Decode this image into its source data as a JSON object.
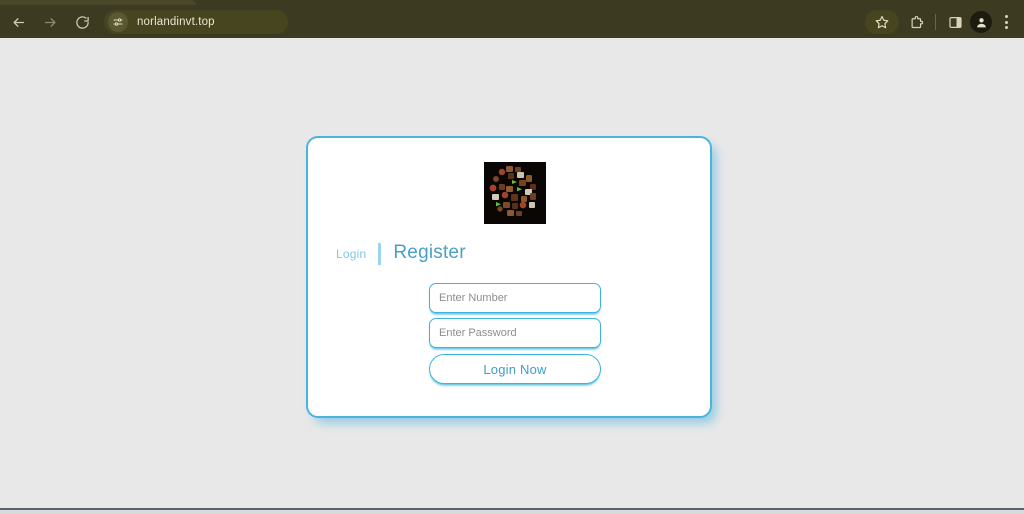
{
  "browser": {
    "url": "norlandinvt.top",
    "nav": {
      "back_label": "Back",
      "forward_label": "Forward",
      "reload_label": "Reload"
    },
    "toolbar": {
      "bookmark_label": "Bookmark this tab",
      "extensions_label": "Extensions",
      "side_panel_label": "Side panel",
      "profile_label": "Profile",
      "menu_label": "Customize and control Chrome"
    },
    "theme": {
      "chrome_bg": "#3c3b22",
      "omnibox_bg": "#46451f",
      "toolbar_text": "#e9e6d2"
    }
  },
  "page": {
    "background": "#e8e8e8",
    "card": {
      "border_color": "#4ab4de",
      "logo": {
        "alt": "food-collage-logo",
        "background": "#090604"
      },
      "tabs": [
        {
          "id": "login",
          "label": "Login",
          "active": false
        },
        {
          "id": "register",
          "label": "Register",
          "active": true
        }
      ],
      "form": {
        "number_placeholder": "Enter Number",
        "number_value": "",
        "password_placeholder": "Enter Password",
        "password_value": "",
        "submit_label": "Login Now",
        "accent_color": "#3fb3dd",
        "submit_text_color": "#3c9fc9"
      }
    }
  }
}
